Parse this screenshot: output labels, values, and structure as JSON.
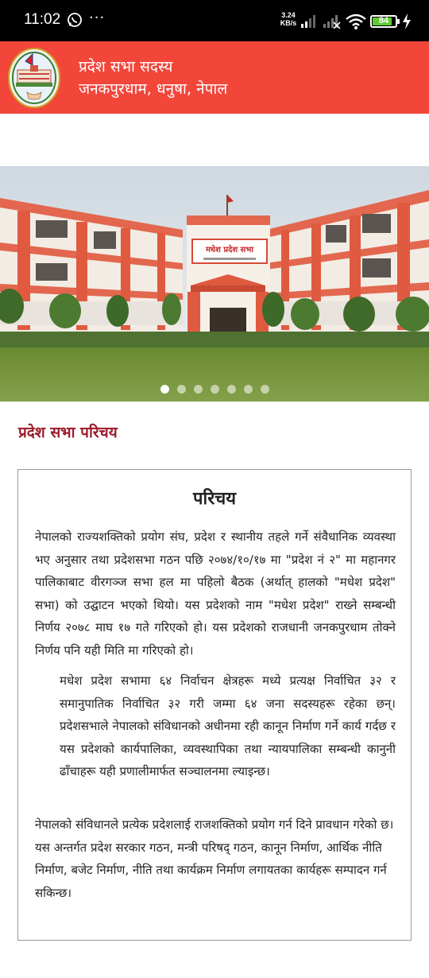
{
  "status_bar": {
    "time": "11:02",
    "more": "···",
    "net_speed_value": "3.24",
    "net_speed_unit": "KB/s",
    "battery_level": "84",
    "battery_percent": 84,
    "battery_color": "#5ecb32",
    "icons": [
      "whatsapp-icon",
      "signal-icon",
      "signal-icon",
      "wifi-icon",
      "battery-icon",
      "charging-icon"
    ]
  },
  "header": {
    "title": "प्रदेश सभा सदस्य",
    "subtitle": "जनकपुरधाम, धनुषा, नेपाल",
    "background_color": "#f2463b"
  },
  "hero": {
    "building_sign": "मधेश प्रदेश सभा",
    "slide_count": 7,
    "active_slide": 1
  },
  "section": {
    "title": "प्रदेश सभा परिचय",
    "title_color": "#9b1b2a"
  },
  "card": {
    "heading": "परिचय",
    "paragraph1": "नेपालको राज्यशक्तिको प्रयोग संघ, प्रदेश र स्थानीय तहले गर्ने संवैधानिक व्यवस्था भए अनुसार तथा प्रदेशसभा गठन पछि २०७४/१०/१७ मा \"प्रदेश नं २\" मा महानगर पालिकाबाट वीरगञ्ज सभा हल मा पहिलो बैठक (अर्थात् हालको \"मधेश प्रदेश\" सभा) को उद्घाटन भएको थियो। यस प्रदेशको नाम \"मधेश प्रदेश\" राख्ने सम्बन्धी निर्णय २०७८ माघ १७ गते गरिएको हो। यस प्रदेशको राजधानी जनकपुरधाम तोक्ने निर्णय पनि यही मिति मा गरिएको हो।",
    "paragraph2": "मधेश प्रदेश सभामा ६४ निर्वाचन क्षेत्रहरू मध्ये प्रत्यक्ष निर्वाचित ३२ र समानुपातिक निर्वाचित ३२ गरी जम्मा ६४ जना सदस्यहरू रहेका छन्। प्रदेशसभाले नेपालको संविधानको अधीनमा रही कानून निर्माण गर्ने कार्य गर्दछ र यस प्रदेशको कार्यपालिका, व्यवस्थापिका तथा न्यायपालिका सम्बन्धी कानुनी ढाँचाहरू यही प्रणालीमार्फत सञ्चालनमा ल्याइन्छ।",
    "paragraph3": "नेपालको संविधानले प्रत्येक प्रदेशलाई राजशक्तिको प्रयोग गर्न दिने प्रावधान गरेको छ। यस अन्तर्गत प्रदेश सरकार गठन, मन्त्री परिषद् गठन, कानून निर्माण, आर्थिक नीति निर्माण, बजेट निर्माण, नीति तथा कार्यक्रम निर्माण लगायतका कार्यहरू सम्पादन गर्न सकिन्छ।"
  }
}
